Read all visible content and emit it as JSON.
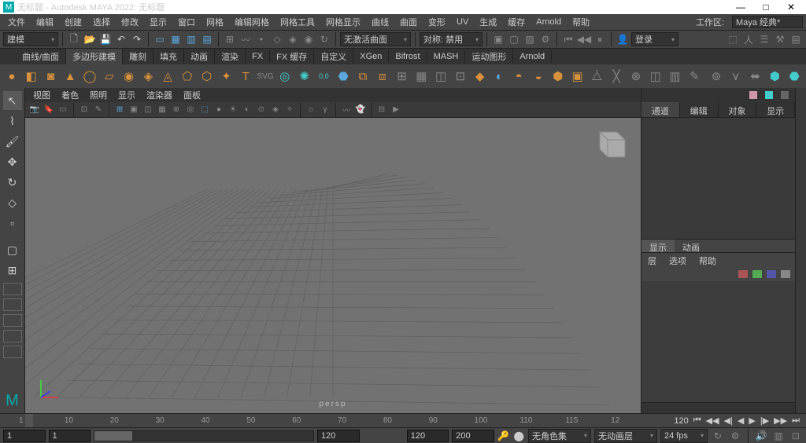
{
  "title": "无标题 - Autodesk MAYA 2022: 无标题",
  "menu": [
    "文件",
    "编辑",
    "创建",
    "选择",
    "修改",
    "显示",
    "窗口",
    "网格",
    "编辑网格",
    "网格工具",
    "网格显示",
    "曲线",
    "曲面",
    "变形",
    "UV",
    "生成",
    "缓存",
    "Arnold",
    "帮助"
  ],
  "workspace": {
    "label": "工作区:",
    "value": "Maya 经典*"
  },
  "toolbar": {
    "mode": "建模",
    "no_active": "无激活曲面",
    "sym_label": "对称: 禁用",
    "login": "登录"
  },
  "shelf_tabs": [
    "曲线/曲面",
    "多边形建模",
    "雕刻",
    "填充",
    "动画",
    "渲染",
    "FX",
    "FX 缓存",
    "自定义",
    "XGen",
    "Bifrost",
    "MASH",
    "运动图形",
    "Arnold"
  ],
  "vp_menu": [
    "视图",
    "着色",
    "照明",
    "显示",
    "渲染器",
    "面板"
  ],
  "vp_label": "persp",
  "right": {
    "tabs": [
      "通道",
      "编辑",
      "对象",
      "显示"
    ],
    "layer_tabs": [
      "显示",
      "动画"
    ],
    "layer_menu": [
      "层",
      "选项",
      "帮助"
    ]
  },
  "timeline": {
    "ticks": [
      "1",
      "10",
      "20",
      "30",
      "40",
      "50",
      "60",
      "70",
      "80",
      "90",
      "100",
      "110",
      "115",
      "12"
    ],
    "end": "120"
  },
  "range": {
    "start": "1",
    "r1": "1",
    "r2": "120",
    "r3": "120",
    "r4": "200",
    "cs": "无角色集",
    "al": "无动画层",
    "fps": "24 fps"
  }
}
